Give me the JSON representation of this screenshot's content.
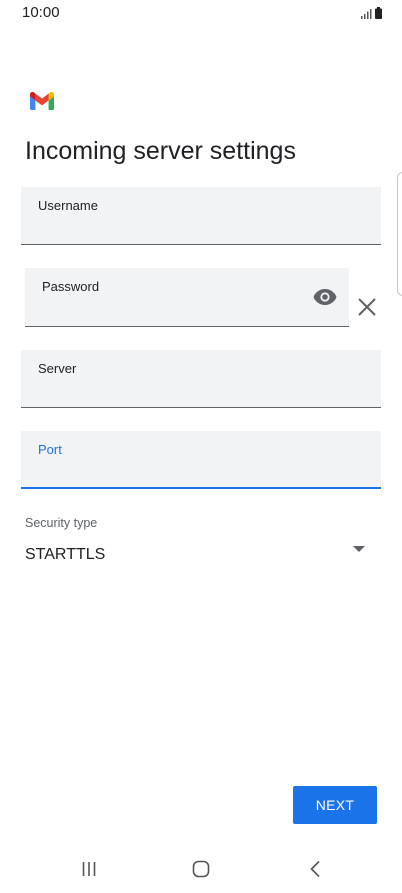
{
  "status_bar": {
    "time": "10:00"
  },
  "app": {
    "logo_icon": "gmail-logo"
  },
  "page": {
    "title": "Incoming server settings"
  },
  "form": {
    "username": {
      "label": "Username",
      "value": ""
    },
    "password": {
      "label": "Password",
      "value": ""
    },
    "server": {
      "label": "Server",
      "value": ""
    },
    "port": {
      "label": "Port",
      "value": ""
    },
    "security_type": {
      "label": "Security type",
      "value": "STARTTLS"
    }
  },
  "actions": {
    "next_label": "NEXT"
  },
  "colors": {
    "accent": "#1a73e8",
    "field_background": "#f1f3f4",
    "underline": "#5f6368"
  },
  "icons": {
    "password_toggle": "eye-icon",
    "clear": "close-icon",
    "security_dropdown": "dropdown-arrow-icon",
    "nav_recent": "recent-apps-icon",
    "nav_home": "home-icon",
    "nav_back": "back-icon"
  }
}
